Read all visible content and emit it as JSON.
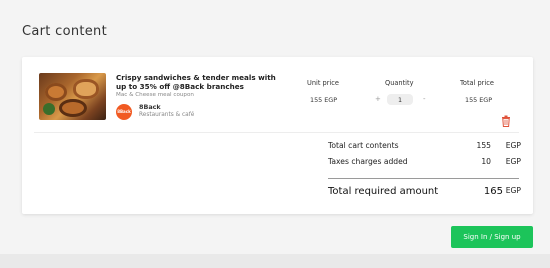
{
  "page": {
    "title": "Cart content"
  },
  "item": {
    "title": "Crispy sandwiches & tender meals with up to 35% off @8Back branches",
    "coupon": "Mac & Cheese meal coupon",
    "vendor_logo_text": "8Back",
    "vendor_name": "8Back",
    "vendor_type": "Restaurants & café",
    "image_icon": "food-photo"
  },
  "columns": {
    "unit_price_label": "Unit price",
    "quantity_label": "Quantity",
    "total_price_label": "Total price"
  },
  "row": {
    "unit_price": "155 EGP",
    "quantity": "1",
    "total_price": "155 EGP",
    "plus": "+",
    "minus": "-",
    "delete_icon": "trash-icon"
  },
  "summary": {
    "total_contents_label": "Total cart contents",
    "total_contents_value": "155",
    "taxes_label": "Taxes charges added",
    "taxes_value": "10",
    "required_label": "Total required amount",
    "required_value": "165",
    "currency": "EGP"
  },
  "actions": {
    "signin_label": "Sign In / Sign up"
  },
  "colors": {
    "accent": "#1cc45a",
    "delete": "#e0533b",
    "vendor": "#f15a22"
  }
}
